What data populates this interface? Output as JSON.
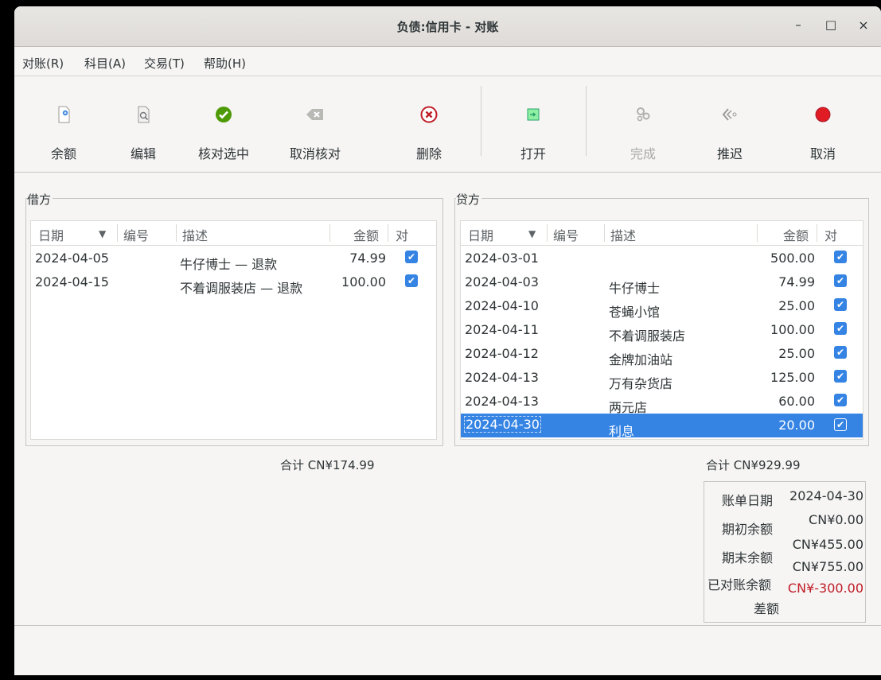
{
  "window": {
    "title": "负债:信用卡 - 对账",
    "minimize": "–",
    "maximize": "□",
    "close": "×"
  },
  "menu": [
    "对账(R)",
    "科目(A)",
    "交易(T)",
    "帮助(H)"
  ],
  "toolbar": [
    {
      "label": "余额",
      "icon": "balance-icon",
      "enabled": true
    },
    {
      "label": "编辑",
      "icon": "edit-icon",
      "enabled": true
    },
    {
      "label": "核对选中",
      "icon": "check-icon",
      "enabled": true
    },
    {
      "label": "取消核对",
      "icon": "backspace-icon",
      "enabled": true
    },
    {
      "label": "删除",
      "icon": "delete-icon",
      "enabled": true
    },
    {
      "label": "打开",
      "icon": "open-icon",
      "enabled": true
    },
    {
      "label": "完成",
      "icon": "finish-icon",
      "enabled": false
    },
    {
      "label": "推迟",
      "icon": "postpone-icon",
      "enabled": true
    },
    {
      "label": "取消",
      "icon": "cancel-icon",
      "enabled": true
    }
  ],
  "debit": {
    "label": "借方",
    "columns": {
      "date": "日期",
      "num": "编号",
      "desc": "描述",
      "amount": "金额",
      "rec": "对"
    },
    "rows": [
      {
        "date": "2024-04-05",
        "num": "",
        "desc": "牛仔博士 — 退款",
        "amount": "74.99",
        "checked": true
      },
      {
        "date": "2024-04-15",
        "num": "",
        "desc": "不着调服装店 — 退款",
        "amount": "100.00",
        "checked": true
      }
    ],
    "total": "合计 CN¥174.99"
  },
  "credit": {
    "label": "贷方",
    "columns": {
      "date": "日期",
      "num": "编号",
      "desc": "描述",
      "amount": "金额",
      "rec": "对"
    },
    "rows": [
      {
        "date": "2024-03-01",
        "num": "",
        "desc": "",
        "amount": "500.00",
        "checked": true
      },
      {
        "date": "2024-04-03",
        "num": "",
        "desc": "牛仔博士",
        "amount": "74.99",
        "checked": true
      },
      {
        "date": "2024-04-10",
        "num": "",
        "desc": "苍蝇小馆",
        "amount": "25.00",
        "checked": true
      },
      {
        "date": "2024-04-11",
        "num": "",
        "desc": "不着调服装店",
        "amount": "100.00",
        "checked": true
      },
      {
        "date": "2024-04-12",
        "num": "",
        "desc": "金牌加油站",
        "amount": "25.00",
        "checked": true
      },
      {
        "date": "2024-04-13",
        "num": "",
        "desc": "万有杂货店",
        "amount": "125.00",
        "checked": true
      },
      {
        "date": "2024-04-13",
        "num": "",
        "desc": "两元店",
        "amount": "60.00",
        "checked": true
      },
      {
        "date": "2024-04-30",
        "num": "",
        "desc": "利息",
        "amount": "20.00",
        "checked": true,
        "selected": true
      }
    ],
    "total": "合计 CN¥929.99"
  },
  "summary": {
    "statement_date_label": "账单日期",
    "statement_date": "2024-04-30",
    "opening_label": "期初余额",
    "opening": "CN¥0.00",
    "ending_label": "期末余额",
    "ending": "CN¥455.00",
    "reconciled_label": "已对账余额",
    "reconciled": "CN¥755.00",
    "difference_label": "差额",
    "difference": "CN¥-300.00"
  },
  "colors": {
    "accent": "#3584e4",
    "negative": "#c01c28"
  }
}
